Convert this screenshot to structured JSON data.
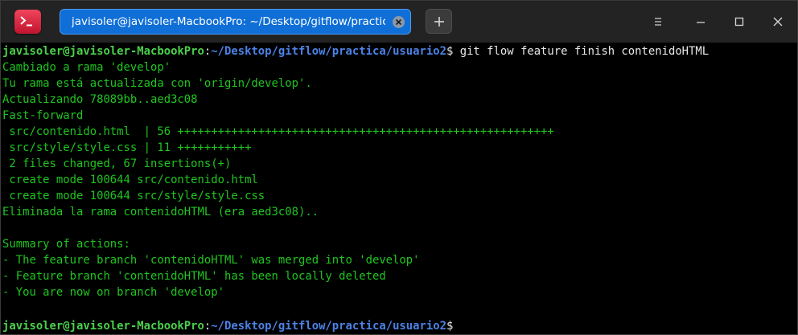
{
  "tab": {
    "title": "javisoler@javisoler-MacbookPro: ~/Desktop/gitflow/practica/..."
  },
  "terminal": {
    "prompt": {
      "user": "javisoler@javisoler-MacbookPro",
      "sep": ":",
      "path": "~/Desktop/gitflow/practica/usuario2",
      "symbol": "$"
    },
    "command": " git flow feature finish contenidoHTML",
    "output": [
      "Cambiado a rama 'develop'",
      "Tu rama está actualizada con 'origin/develop'.",
      "Actualizando 78089bb..aed3c08",
      "Fast-forward",
      " src/contenido.html  | 56 ++++++++++++++++++++++++++++++++++++++++++++++++++++++++",
      " src/style/style.css | 11 +++++++++++",
      " 2 files changed, 67 insertions(+)",
      " create mode 100644 src/contenido.html",
      " create mode 100644 src/style/style.css",
      "Eliminada la rama contenidoHTML (era aed3c08)..",
      "",
      "Summary of actions:",
      "- The feature branch 'contenidoHTML' was merged into 'develop'",
      "- Feature branch 'contenidoHTML' has been locally deleted",
      "- You are now on branch 'develop'",
      ""
    ]
  },
  "colors": {
    "tab_active": "#0f6fd7",
    "terminal_bg": "#000000",
    "output_text": "#1fc51f",
    "prompt_user": "#4bd14b",
    "prompt_path": "#4c82e6"
  }
}
